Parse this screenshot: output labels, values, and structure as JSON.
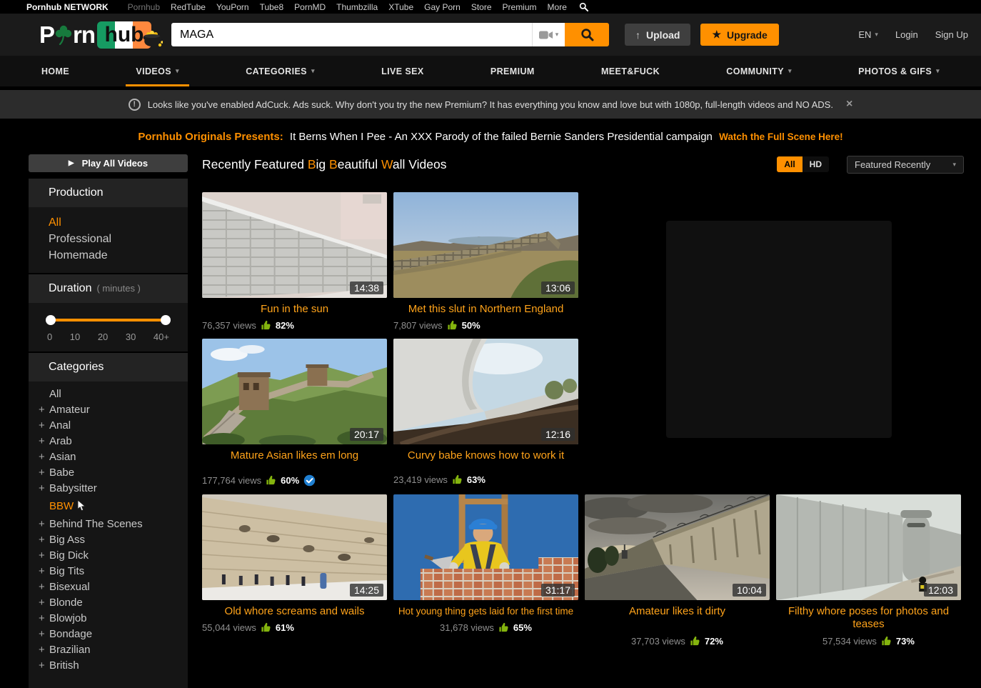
{
  "icons": {
    "dropdown": "▾",
    "close": "×",
    "star": "★",
    "up_arrow": "↑",
    "play": "▶",
    "plus": "+",
    "exclamation": "!"
  },
  "colors": {
    "accent": "#ff9000",
    "video_title": "#ffa31a",
    "thumbs_up_green": "#84b40e",
    "verified_blue": "#1f7fd1"
  },
  "network_bar": {
    "brand": "Pornhub NETWORK",
    "links": [
      "Pornhub",
      "RedTube",
      "YouPorn",
      "Tube8",
      "PornMD",
      "Thumbzilla",
      "XTube",
      "Gay Porn",
      "Store",
      "Premium",
      "More"
    ]
  },
  "header": {
    "logo": {
      "part1": "P",
      "part2": "rn",
      "part3": "hub"
    },
    "search": {
      "value": "MAGA"
    },
    "upload_label": "Upload",
    "upgrade_label": "Upgrade",
    "language": "EN",
    "login_label": "Login",
    "signup_label": "Sign Up"
  },
  "nav": {
    "items": [
      {
        "label": "HOME",
        "has_dropdown": false
      },
      {
        "label": "VIDEOS",
        "has_dropdown": true,
        "active": true
      },
      {
        "label": "CATEGORIES",
        "has_dropdown": true
      },
      {
        "label": "LIVE SEX",
        "has_dropdown": false
      },
      {
        "label": "PREMIUM",
        "has_dropdown": false
      },
      {
        "label": "MEET&FUCK",
        "has_dropdown": false
      },
      {
        "label": "COMMUNITY",
        "has_dropdown": true
      },
      {
        "label": "PHOTOS & GIFS",
        "has_dropdown": true
      }
    ]
  },
  "notice": {
    "text": "Looks like you've enabled AdCuck. Ads suck. Why don't you try the new Premium? It has everything you know and love but with 1080p, full-length videos and NO ADS."
  },
  "banner": {
    "prefix": "Pornhub Originals Presents:",
    "title": "It Berns When I Pee - An XXX Parody of the failed Bernie Sanders Presidential campaign",
    "cta": "Watch the Full Scene Here!"
  },
  "sidebar": {
    "play_all_label": "Play All Videos",
    "production": {
      "title": "Production",
      "items": [
        "All",
        "Professional",
        "Homemade"
      ],
      "selected": "All"
    },
    "duration": {
      "title": "Duration",
      "subtitle": "( minutes )",
      "ticks": [
        "0",
        "10",
        "20",
        "30",
        "40+"
      ]
    },
    "categories": {
      "title": "Categories",
      "selected": "BBW",
      "items": [
        {
          "label": "All",
          "expandable": false
        },
        {
          "label": "Amateur",
          "expandable": true
        },
        {
          "label": "Anal",
          "expandable": true
        },
        {
          "label": "Arab",
          "expandable": true
        },
        {
          "label": "Asian",
          "expandable": true
        },
        {
          "label": "Babe",
          "expandable": true
        },
        {
          "label": "Babysitter",
          "expandable": true
        },
        {
          "label": "BBW",
          "expandable": false
        },
        {
          "label": "Behind The Scenes",
          "expandable": true
        },
        {
          "label": "Big Ass",
          "expandable": true
        },
        {
          "label": "Big Dick",
          "expandable": true
        },
        {
          "label": "Big Tits",
          "expandable": true
        },
        {
          "label": "Bisexual",
          "expandable": true
        },
        {
          "label": "Blonde",
          "expandable": true
        },
        {
          "label": "Blowjob",
          "expandable": true
        },
        {
          "label": "Bondage",
          "expandable": true
        },
        {
          "label": "Brazilian",
          "expandable": true
        },
        {
          "label": "British",
          "expandable": true
        }
      ]
    }
  },
  "main": {
    "heading": {
      "p1": "Recently Featured ",
      "b1": "B",
      "p2": "ig ",
      "b2": "B",
      "p3": "eautiful ",
      "b3": "W",
      "p4": "all Videos"
    },
    "filter_all": "All",
    "filter_hd": "HD",
    "sort_label": "Featured Recently",
    "videos": [
      {
        "title": "Fun in the sun",
        "duration": "14:38",
        "views": "76,357 views",
        "rating": "82%",
        "verified": false
      },
      {
        "title": "Met this slut in Northern England",
        "duration": "13:06",
        "views": "7,807 views",
        "rating": "50%",
        "verified": false
      },
      {
        "title": "Mature Asian likes em long",
        "duration": "20:17",
        "views": "177,764 views",
        "rating": "60%",
        "verified": true
      },
      {
        "title": "Curvy babe knows how to work it",
        "duration": "12:16",
        "views": "23,419 views",
        "rating": "63%",
        "verified": false
      },
      {
        "title": "Old whore screams and wails",
        "duration": "14:25",
        "views": "55,044 views",
        "rating": "61%",
        "verified": false
      },
      {
        "title": "Hot young thing gets laid for the first time",
        "duration": "31:17",
        "views": "31,678 views",
        "rating": "65%",
        "verified": false
      },
      {
        "title": "Amateur likes it dirty",
        "duration": "10:04",
        "views": "37,703 views",
        "rating": "72%",
        "verified": false
      },
      {
        "title": "Filthy whore poses for photos and teases",
        "duration": "12:03",
        "views": "57,534 views",
        "rating": "73%",
        "verified": false
      }
    ]
  }
}
